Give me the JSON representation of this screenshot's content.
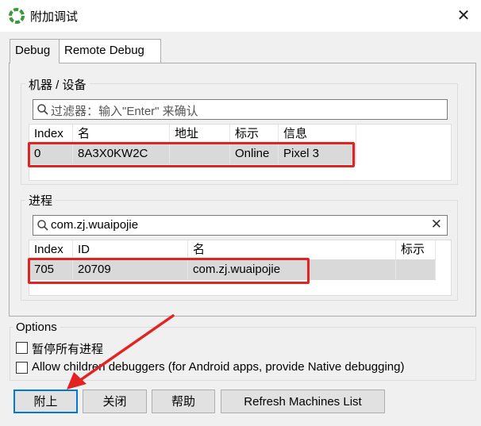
{
  "window": {
    "title": "附加调试",
    "close": "✕"
  },
  "tabs": [
    {
      "label": "Debug"
    },
    {
      "label": "Remote Debug"
    }
  ],
  "devices": {
    "group_label": "机器 / 设备",
    "filter_placeholder": "过滤器：输入\"Enter\" 来确认",
    "columns": [
      "Index",
      "名",
      "地址",
      "标示",
      "信息"
    ],
    "rows": [
      {
        "index": "0",
        "name": "8A3X0KW2C",
        "address": "",
        "status": "Online",
        "info": "Pixel 3"
      }
    ]
  },
  "processes": {
    "group_label": "进程",
    "filter_value": "com.zj.wuaipojie",
    "clear": "✕",
    "columns": [
      "Index",
      "ID",
      "名",
      "标示"
    ],
    "rows": [
      {
        "index": "705",
        "id": "20709",
        "name": "com.zj.wuaipojie",
        "flag": ""
      }
    ]
  },
  "options": {
    "label": "Options",
    "items": [
      {
        "label": "暂停所有进程",
        "checked": false
      },
      {
        "label": "Allow children debuggers (for Android apps, provide Native debugging)",
        "checked": false
      }
    ]
  },
  "buttons": {
    "attach": "附上",
    "close": "关闭",
    "help": "帮助",
    "refresh": "Refresh Machines List"
  },
  "colors": {
    "highlight": "#e32222",
    "selection": "#d9d9d9",
    "default_button_border": "#0078d7"
  }
}
